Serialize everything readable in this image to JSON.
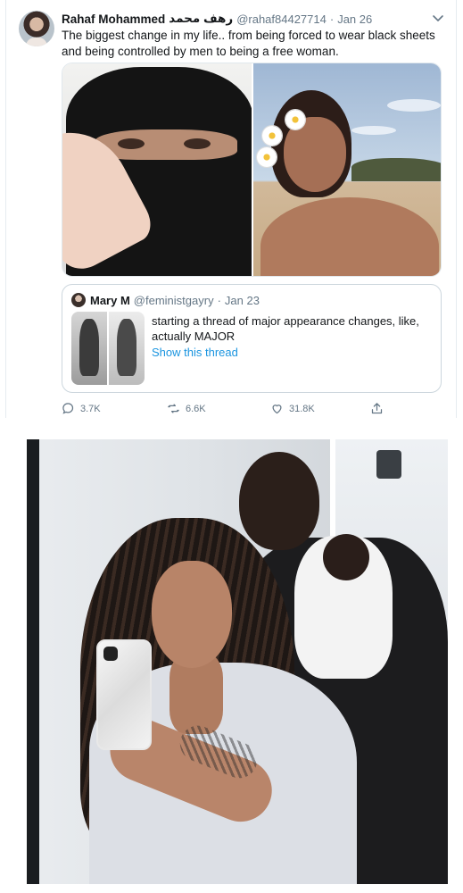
{
  "tweet": {
    "author_name": "Rahaf Mohammed",
    "author_name_arabic": "رهف محمد",
    "handle": "@rahaf84427714",
    "separator": "·",
    "date": "Jan 26",
    "text": "The biggest change in my life.. from being forced to wear black sheets and being controlled by men to being a free woman.",
    "media": [
      {
        "icon": "image-icon",
        "description_name": "before-photo"
      },
      {
        "icon": "image-icon",
        "description_name": "after-photo"
      }
    ],
    "quote": {
      "author_name": "Mary M",
      "handle": "@feministgayry",
      "separator": "·",
      "date": "Jan 23",
      "text": "starting a thread of major appearance changes, like, actually MAJOR",
      "link": "Show this thread"
    },
    "actions": {
      "reply_count": "3.7K",
      "retweet_count": "6.6K",
      "like_count": "31.8K"
    },
    "colors": {
      "link": "#1b95e0",
      "secondary_text": "#657786",
      "primary_text": "#14171a",
      "border": "#ccd6dd"
    }
  },
  "photo": {
    "icon": "image-icon"
  }
}
